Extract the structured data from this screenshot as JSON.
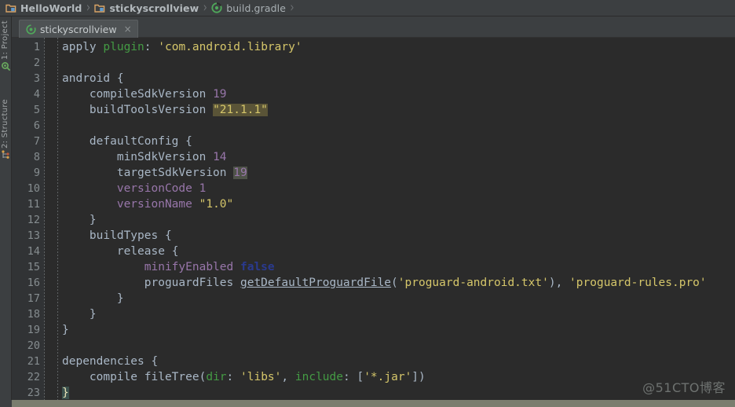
{
  "breadcrumb": {
    "items": [
      {
        "label": "HelloWorld",
        "icon": "folder-module-icon",
        "bold": true
      },
      {
        "label": "stickyscrollview",
        "icon": "folder-module-icon",
        "bold": true
      },
      {
        "label": "build.gradle",
        "icon": "gradle-file-icon",
        "bold": false
      }
    ],
    "separator": "›"
  },
  "left_strip": {
    "buttons": [
      {
        "label": "1: Project",
        "icon": "project-icon"
      },
      {
        "label": "2: Structure",
        "icon": "structure-icon"
      }
    ]
  },
  "editor_tabs": [
    {
      "label": "stickyscrollview",
      "icon": "gradle-file-icon",
      "close": "×",
      "active": true
    }
  ],
  "editor": {
    "language": "groovy",
    "first_line": 1,
    "last_line": 23,
    "lines": [
      {
        "n": "1",
        "tokens": [
          {
            "t": "apply ",
            "c": "t-def"
          },
          {
            "t": "plugin",
            "c": "t-green"
          },
          {
            "t": ": ",
            "c": "t-punc"
          },
          {
            "t": "'com.android.library'",
            "c": "t-str"
          }
        ]
      },
      {
        "n": "2",
        "tokens": []
      },
      {
        "n": "3",
        "tokens": [
          {
            "t": "android ",
            "c": "t-def"
          },
          {
            "t": "{",
            "c": "t-brace"
          }
        ]
      },
      {
        "n": "4",
        "tokens": [
          {
            "t": "    compileSdkVersion ",
            "c": "t-def"
          },
          {
            "t": "19",
            "c": "t-num"
          }
        ]
      },
      {
        "n": "5",
        "tokens": [
          {
            "t": "    buildToolsVersion ",
            "c": "t-def"
          },
          {
            "t": "\"21.1.1\"",
            "c": "t-str hl"
          }
        ]
      },
      {
        "n": "6",
        "tokens": []
      },
      {
        "n": "7",
        "tokens": [
          {
            "t": "    defaultConfig ",
            "c": "t-def"
          },
          {
            "t": "{",
            "c": "t-brace"
          }
        ]
      },
      {
        "n": "8",
        "tokens": [
          {
            "t": "        minSdkVersion ",
            "c": "t-def"
          },
          {
            "t": "14",
            "c": "t-num"
          }
        ]
      },
      {
        "n": "9",
        "tokens": [
          {
            "t": "        targetSdkVersion ",
            "c": "t-def"
          },
          {
            "t": "19",
            "c": "t-num hl2"
          }
        ]
      },
      {
        "n": "10",
        "tokens": [
          {
            "t": "        versionCode ",
            "c": "t-prop"
          },
          {
            "t": "1",
            "c": "t-num"
          }
        ]
      },
      {
        "n": "11",
        "tokens": [
          {
            "t": "        versionName ",
            "c": "t-prop"
          },
          {
            "t": "\"1.0\"",
            "c": "t-str"
          }
        ]
      },
      {
        "n": "12",
        "tokens": [
          {
            "t": "    }",
            "c": "t-brace"
          }
        ]
      },
      {
        "n": "13",
        "tokens": [
          {
            "t": "    buildTypes ",
            "c": "t-def"
          },
          {
            "t": "{",
            "c": "t-brace"
          }
        ]
      },
      {
        "n": "14",
        "tokens": [
          {
            "t": "        release ",
            "c": "t-def"
          },
          {
            "t": "{",
            "c": "t-brace"
          }
        ]
      },
      {
        "n": "15",
        "tokens": [
          {
            "t": "            minifyEnabled ",
            "c": "t-prop"
          },
          {
            "t": "false",
            "c": "t-bool"
          }
        ]
      },
      {
        "n": "16",
        "tokens": [
          {
            "t": "            proguardFiles ",
            "c": "t-def"
          },
          {
            "t": "getDefaultProguardFile",
            "c": "t-fn"
          },
          {
            "t": "(",
            "c": "t-punc"
          },
          {
            "t": "'proguard-android.txt'",
            "c": "t-str"
          },
          {
            "t": "), ",
            "c": "t-punc"
          },
          {
            "t": "'proguard-rules.pro'",
            "c": "t-str"
          }
        ]
      },
      {
        "n": "17",
        "tokens": [
          {
            "t": "        }",
            "c": "t-brace"
          }
        ]
      },
      {
        "n": "18",
        "tokens": [
          {
            "t": "    }",
            "c": "t-brace"
          }
        ]
      },
      {
        "n": "19",
        "tokens": [
          {
            "t": "}",
            "c": "t-brace"
          }
        ]
      },
      {
        "n": "20",
        "tokens": []
      },
      {
        "n": "21",
        "tokens": [
          {
            "t": "dependencies ",
            "c": "t-def"
          },
          {
            "t": "{",
            "c": "t-brace"
          }
        ]
      },
      {
        "n": "22",
        "tokens": [
          {
            "t": "    compile fileTree",
            "c": "t-def"
          },
          {
            "t": "(",
            "c": "t-punc"
          },
          {
            "t": "dir",
            "c": "t-green"
          },
          {
            "t": ": ",
            "c": "t-punc"
          },
          {
            "t": "'libs'",
            "c": "t-str"
          },
          {
            "t": ", ",
            "c": "t-punc"
          },
          {
            "t": "include",
            "c": "t-green"
          },
          {
            "t": ": [",
            "c": "t-punc"
          },
          {
            "t": "'*.jar'",
            "c": "t-str"
          },
          {
            "t": "])",
            "c": "t-punc"
          }
        ]
      },
      {
        "n": "23",
        "tokens": [
          {
            "t": "}",
            "c": "t-brace-hl"
          }
        ]
      }
    ]
  },
  "watermark": {
    "text": "@51CTO博客"
  },
  "colors": {
    "window_chrome": "#3c3f41",
    "editor_background": "#2b2b2b",
    "gutter_background": "#313335",
    "default_text": "#a9b7c6",
    "string": "#d5c66a",
    "number": "#9876aa",
    "property": "#9876aa",
    "named_arg": "#449b44",
    "boolean": "#2a3a8f",
    "search_highlight": "#5a5437",
    "bottom_bar": "#7a7d6e"
  }
}
